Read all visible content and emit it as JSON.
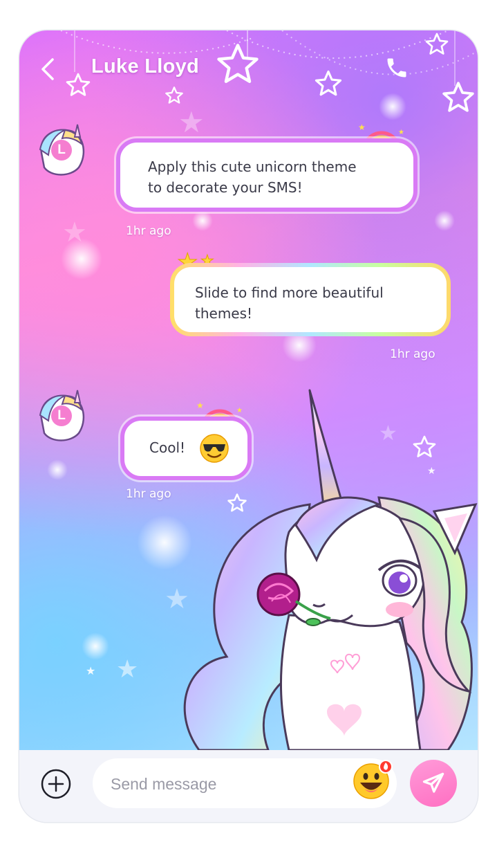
{
  "contact": {
    "name": "Luke Lloyd",
    "avatar_letter": "L"
  },
  "messages": [
    {
      "direction": "incoming",
      "text_lines": [
        "Apply this cute unicorn theme",
        "to decorate your SMS!"
      ],
      "time": "1hr ago"
    },
    {
      "direction": "outgoing",
      "text_lines": [
        "Slide to find more beautiful",
        "themes!"
      ],
      "time": "1hr ago"
    },
    {
      "direction": "incoming",
      "text": "Cool!",
      "emoji": "sunglasses-face",
      "time": "1hr ago"
    }
  ],
  "composer": {
    "placeholder": "Send message"
  },
  "icons": {
    "back": "chevron-left-icon",
    "call": "phone-icon",
    "add": "plus-circle-icon",
    "emoji": "grinning-face-icon",
    "send": "paper-plane-icon"
  },
  "colors": {
    "incoming_border": "#d97af5",
    "send_button": "#ff6fc2",
    "avatar_letter_bg": "#f57ed0"
  }
}
